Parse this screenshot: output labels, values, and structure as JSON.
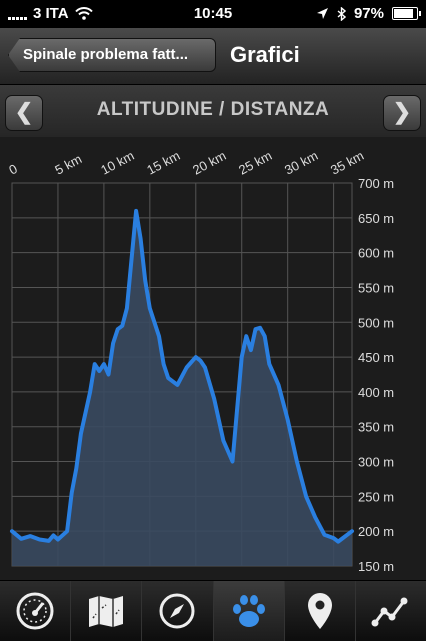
{
  "status_bar": {
    "carrier": "3 ITA",
    "time": "10:45",
    "battery_text": "97%",
    "battery_level": 0.97
  },
  "nav": {
    "back_label": "Spinale problema fatt...",
    "title": "Grafici"
  },
  "chart_header": {
    "title": "ALTITUDINE / DISTANZA",
    "prev_icon": "chevron-left-icon",
    "next_icon": "chevron-right-icon"
  },
  "tabs": [
    {
      "icon": "speedometer-icon",
      "active": false
    },
    {
      "icon": "map-icon",
      "active": false
    },
    {
      "icon": "compass-icon",
      "active": false
    },
    {
      "icon": "paw-icon",
      "active": true
    },
    {
      "icon": "location-pin-icon",
      "active": false
    },
    {
      "icon": "line-graph-icon",
      "active": false
    }
  ],
  "colors": {
    "line": "#2a7fe0",
    "fill": "#3a4a60",
    "grid": "#555555",
    "tab_active": "#3a8fe8"
  },
  "chart_data": {
    "type": "area",
    "title": "ALTITUDINE / DISTANZA",
    "xlabel": "",
    "ylabel": "",
    "x_ticks": [
      "0",
      "5 km",
      "10 km",
      "15 km",
      "20 km",
      "25 km",
      "30 km",
      "35 km"
    ],
    "y_ticks": [
      "700 m",
      "650 m",
      "600 m",
      "550 m",
      "500 m",
      "450 m",
      "400 m",
      "350 m",
      "300 m",
      "250 m",
      "200 m",
      "150 m"
    ],
    "xlim": [
      0,
      37
    ],
    "ylim": [
      150,
      700
    ],
    "grid": true,
    "series": [
      {
        "x": [
          0,
          1,
          2,
          3,
          4,
          4.5,
          5,
          6,
          6.5,
          7,
          7.5,
          8,
          8.5,
          9,
          9.5,
          10,
          10.5,
          11,
          11.5,
          12,
          12.5,
          13,
          13.5,
          14,
          14.5,
          15,
          16,
          16.5,
          17,
          18,
          19,
          20,
          20.5,
          21,
          22,
          23,
          24,
          25,
          25.5,
          26,
          26.5,
          27,
          27.5,
          28,
          29,
          30,
          31,
          32,
          33,
          34,
          35,
          35.5,
          36,
          37
        ],
        "y": [
          200,
          189,
          193,
          188,
          186,
          194,
          188,
          200,
          255,
          290,
          340,
          370,
          400,
          440,
          430,
          440,
          425,
          470,
          490,
          495,
          520,
          590,
          660,
          620,
          560,
          520,
          480,
          440,
          420,
          410,
          435,
          450,
          445,
          435,
          390,
          330,
          300,
          450,
          480,
          460,
          490,
          492,
          480,
          440,
          410,
          360,
          300,
          250,
          220,
          195,
          190,
          185,
          190,
          200
        ]
      }
    ]
  }
}
